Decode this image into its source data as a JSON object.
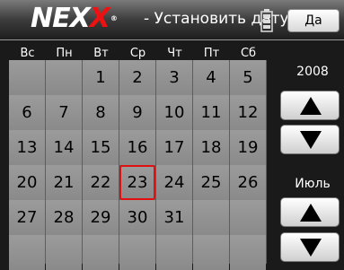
{
  "header": {
    "logo_main": "NEX",
    "logo_accent": "X",
    "logo_reg": "®",
    "title": "- Установить дату",
    "ok_label": "Да"
  },
  "weekdays": [
    "Вс",
    "Пн",
    "Вт",
    "Ср",
    "Чт",
    "Пт",
    "Сб"
  ],
  "calendar": {
    "rows": [
      [
        "",
        "",
        "1",
        "2",
        "3",
        "4",
        "5"
      ],
      [
        "6",
        "7",
        "8",
        "9",
        "10",
        "11",
        "12"
      ],
      [
        "13",
        "14",
        "15",
        "16",
        "17",
        "18",
        "19"
      ],
      [
        "20",
        "21",
        "22",
        "23",
        "24",
        "25",
        "26"
      ],
      [
        "27",
        "28",
        "29",
        "30",
        "31",
        "",
        ""
      ],
      [
        "",
        "",
        "",
        "",
        "",
        "",
        ""
      ]
    ],
    "selected_day": "23"
  },
  "year": {
    "label": "2008",
    "up_icon": "arrow-up-icon",
    "down_icon": "arrow-down-icon"
  },
  "month": {
    "label": "Июль",
    "up_icon": "arrow-up-icon",
    "down_icon": "arrow-down-icon"
  },
  "colors": {
    "accent": "#e01010",
    "cell": "#959595",
    "background": "#1a1a1a"
  }
}
